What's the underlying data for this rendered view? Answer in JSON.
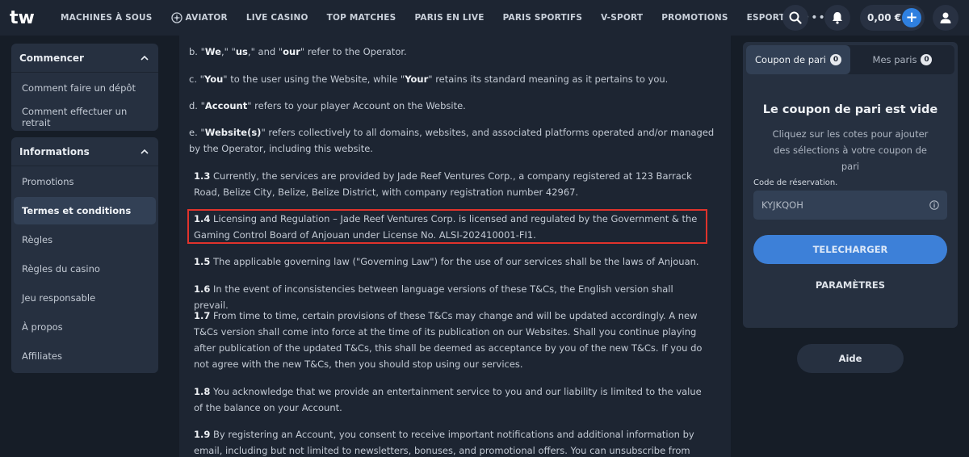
{
  "brand": {
    "logo_text": "tw",
    "accent": "#2f80e0",
    "highlight": "#e0332c"
  },
  "nav": {
    "items": [
      "MACHINES À SOUS",
      "AVIATOR",
      "LIVE CASINO",
      "TOP MATCHES",
      "PARIS EN LIVE",
      "PARIS SPORTIFS",
      "V-SPORT",
      "PROMOTIONS",
      "ESPORT"
    ],
    "more": "•••"
  },
  "account": {
    "balance": "0,00 €",
    "plus": "+"
  },
  "sidebar": {
    "sections": [
      {
        "title": "Commencer",
        "items": [
          "Comment faire un dépôt",
          "Comment effectuer un retrait"
        ]
      },
      {
        "title": "Informations",
        "items": [
          "Promotions",
          "Termes et conditions",
          "Règles",
          "Règles du casino",
          "Jeu responsable",
          "À propos",
          "Affiliates"
        ],
        "active": "Termes et conditions"
      }
    ]
  },
  "content": {
    "b_prefix": "b. \"",
    "b_we": "We",
    "b_mid1": ",\" \"",
    "b_us": "us",
    "b_mid2": ",\" and \"",
    "b_our": "our",
    "b_tail": "\" refer to the Operator.",
    "c_prefix": "c. \"",
    "c_you": "You",
    "c_mid": "\" to the user using the Website, while \"",
    "c_your": "Your",
    "c_tail": "\" retains its standard meaning as it pertains to you.",
    "d_prefix": "d. \"",
    "d_account": "Account",
    "d_tail": "\" refers to your player Account on the Website.",
    "e_prefix": "e. \"",
    "e_website": "Website(s)",
    "e_tail": "\" refers collectively to all domains, websites, and associated platforms operated and/or managed by the Operator, including this website.",
    "s13_num": "1.3",
    "s13_text": " Currently, the services are provided by Jade Reef Ventures Corp., a company registered at 123 Barrack Road, Belize City, Belize, Belize District, with company registration number 42967.",
    "s14_num": "1.4",
    "s14_text": " Licensing and Regulation – Jade Reef Ventures Corp. is licensed and regulated by the Government & the Gaming Control Board of Anjouan under License No. ALSI-202410001-FI1.",
    "s15_num": "1.5",
    "s15_text": " The applicable governing law (\"Governing Law\") for the use of our services shall be the laws of Anjouan.",
    "s16_num": "1.6",
    "s16_text": " In the event of inconsistencies between language versions of these T&Cs, the English version shall prevail.",
    "s17_num": "1.7",
    "s17_text": " From time to time, certain provisions of these T&Cs may change and will be updated accordingly. A new T&Cs version shall come into force at the time of its publication on our Websites. Shall you continue playing after publication of the updated T&Cs, this shall be deemed as acceptance by you of the new T&Cs. If you do not agree with the new T&Cs, then you should stop using our services.",
    "s18_num": "1.8",
    "s18_text": " You acknowledge that we provide an entertainment service to you and our liability is limited to the value of the balance on your Account.",
    "s19_num": "1.9",
    "s19_text": " By registering an Account, you consent to receive important notifications and additional information by email, including but not limited to newsletters, bonuses, and promotional offers. You can unsubscribe from marketing"
  },
  "betslip": {
    "tab_coupon": "Coupon de pari",
    "tab_coupon_count": "0",
    "tab_mybets": "Mes paris",
    "tab_mybets_count": "0",
    "empty_title": "Le coupon de pari est vide",
    "empty_text": "Cliquez sur les cotes pour ajouter des sélections à votre coupon de pari",
    "code_label": "Code de réservation.",
    "code_value": "KYJKQOH",
    "download": "TELECHARGER",
    "settings": "PARAMÈTRES"
  },
  "help": "Aide"
}
